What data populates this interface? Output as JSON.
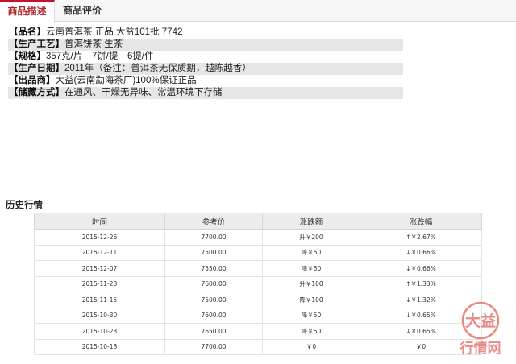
{
  "tabs": [
    {
      "label": "商品描述",
      "active": true
    },
    {
      "label": "商品评价",
      "active": false
    }
  ],
  "specs": [
    {
      "key": "【品名】",
      "value": "云南普洱茶 正品 大益101批 7742"
    },
    {
      "key": "【生产工艺】",
      "value": "普洱饼茶 生茶"
    },
    {
      "key": "【规格】",
      "value": "357克/片　7饼/提　6提/件"
    },
    {
      "key": "【生产日期】",
      "value": "2011年（备注：普洱茶无保质期，越陈越香）"
    },
    {
      "key": "【出品商】",
      "value": "大益(云南勐海茶厂)100%保证正品"
    },
    {
      "key": "【储藏方式】",
      "value": "在通风、干燥无异味、常温环境下存储"
    }
  ],
  "history": {
    "title": "历史行情",
    "columns": [
      "时间",
      "参考价",
      "涨跌额",
      "涨跌幅"
    ],
    "rows": [
      {
        "date": "2015-12-26",
        "price": "7700.00",
        "change": "升￥200",
        "pct": "↑￥2.67%",
        "dir": "up"
      },
      {
        "date": "2015-12-11",
        "price": "7500.00",
        "change": "降￥50",
        "pct": "↓￥0.66%",
        "dir": "down"
      },
      {
        "date": "2015-12-07",
        "price": "7550.00",
        "change": "降￥50",
        "pct": "↓￥0.66%",
        "dir": "down"
      },
      {
        "date": "2015-11-28",
        "price": "7600.00",
        "change": "升￥100",
        "pct": "↑￥1.33%",
        "dir": "up"
      },
      {
        "date": "2015-11-15",
        "price": "7500.00",
        "change": "降￥100",
        "pct": "↓￥1.32%",
        "dir": "down"
      },
      {
        "date": "2015-10-30",
        "price": "7600.00",
        "change": "降￥50",
        "pct": "↓￥0.65%",
        "dir": "down"
      },
      {
        "date": "2015-10-23",
        "price": "7650.00",
        "change": "降￥50",
        "pct": "↓￥0.65%",
        "dir": "down"
      },
      {
        "date": "2015-10-18",
        "price": "7700.00",
        "change": "￥0",
        "pct": "￥0",
        "dir": "flat"
      }
    ]
  },
  "logo": {
    "top_text": "大益",
    "bottom_text": "行情网",
    "color": "#d9534f"
  },
  "colors": {
    "accent": "#c8102e",
    "up": "#e02020",
    "down": "#1a9a1a"
  }
}
